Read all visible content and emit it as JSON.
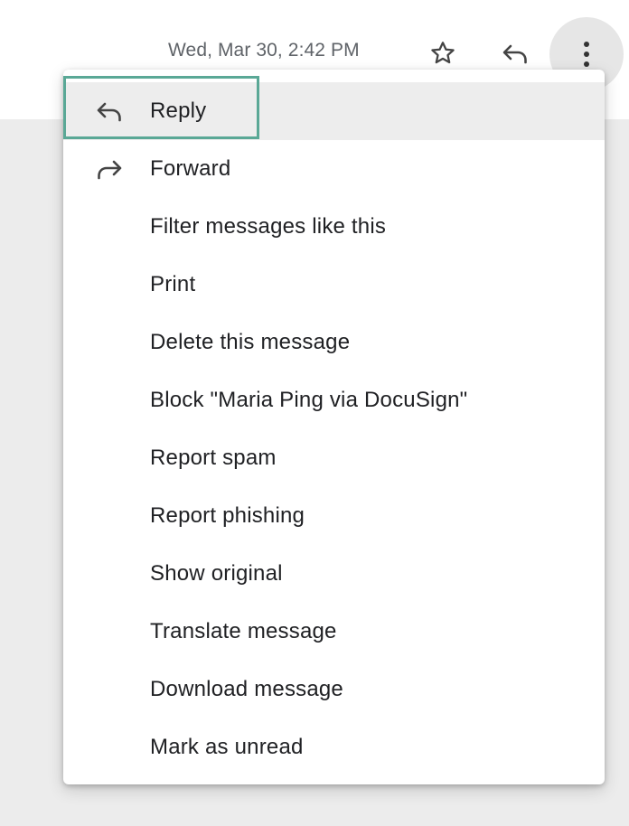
{
  "header": {
    "timestamp": "Wed, Mar 30, 2:42 PM",
    "star_icon": "star-outline-icon",
    "reply_icon": "reply-icon",
    "more_icon": "more-vertical-icon"
  },
  "menu": {
    "items": [
      {
        "label": "Reply",
        "icon": "reply-icon",
        "active": true
      },
      {
        "label": "Forward",
        "icon": "forward-icon",
        "active": false
      },
      {
        "label": "Filter messages like this",
        "icon": "",
        "active": false
      },
      {
        "label": "Print",
        "icon": "",
        "active": false
      },
      {
        "label": "Delete this message",
        "icon": "",
        "active": false
      },
      {
        "label": "Block \"Maria Ping via DocuSign\"",
        "icon": "",
        "active": false
      },
      {
        "label": "Report spam",
        "icon": "",
        "active": false
      },
      {
        "label": "Report phishing",
        "icon": "",
        "active": false
      },
      {
        "label": "Show original",
        "icon": "",
        "active": false
      },
      {
        "label": "Translate message",
        "icon": "",
        "active": false
      },
      {
        "label": "Download message",
        "icon": "",
        "active": false
      },
      {
        "label": "Mark as unread",
        "icon": "",
        "active": false
      }
    ]
  },
  "colors": {
    "highlight_border": "#5aa896",
    "active_row": "#ededed",
    "text": "#202124",
    "muted_text": "#5f6368"
  }
}
